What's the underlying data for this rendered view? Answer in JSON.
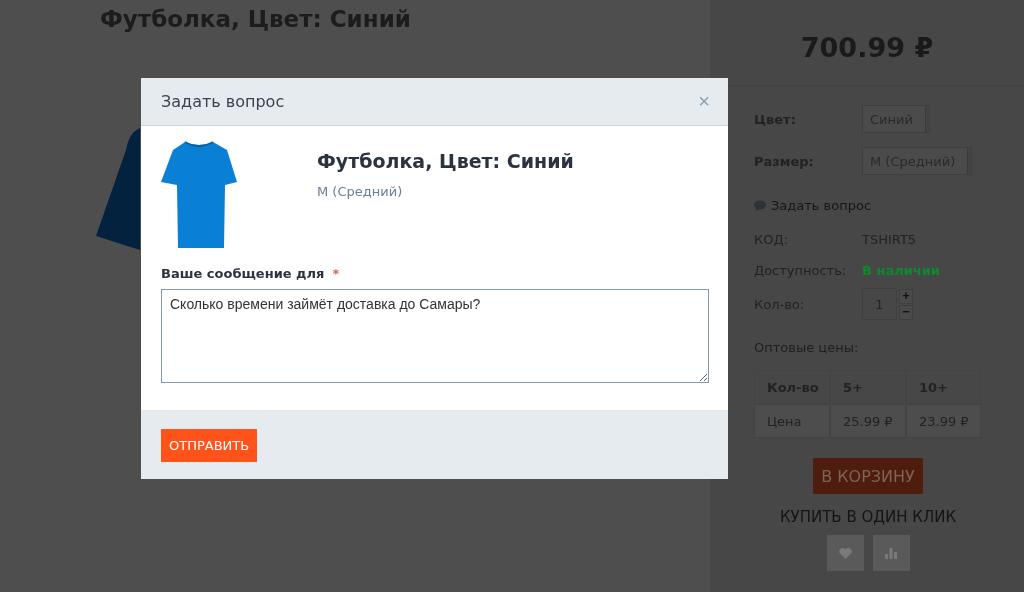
{
  "page": {
    "title": "Футболка, Цвет: Синий",
    "price": "700.99 ₽",
    "options": [
      {
        "label": "Цвет:",
        "value": "Синий"
      },
      {
        "label": "Размер:",
        "value": "M (Средний)"
      }
    ],
    "ask_link": "Задать вопрос",
    "specs": [
      {
        "label": "КОД:",
        "value": "TSHIRT5",
        "kind": "text"
      },
      {
        "label": "Доступность:",
        "value": "В наличии",
        "kind": "status"
      },
      {
        "label": "Кол-во:",
        "value": "1",
        "kind": "quantity"
      }
    ],
    "quantity_plus": "+",
    "quantity_minus": "−",
    "wholesale": {
      "title": "Оптовые цены:",
      "columns": [
        "Кол-во",
        "5+",
        "10+"
      ],
      "rows": [
        [
          "Цена",
          "25.99 ₽",
          "23.99 ₽"
        ]
      ]
    },
    "cart_button": "В КОРЗИНУ",
    "one_click": "КУПИТЬ В ОДИН КЛИК"
  },
  "modal": {
    "title": "Задать вопрос",
    "close": "×",
    "product_title": "Футболка, Цвет: Синий",
    "variant": "M (Средний)",
    "field_label": "Ваше сообщение для",
    "required_mark": "*",
    "message": "Сколько времени займёт доставка до Самары?",
    "submit": "ОТПРАВИТЬ"
  }
}
